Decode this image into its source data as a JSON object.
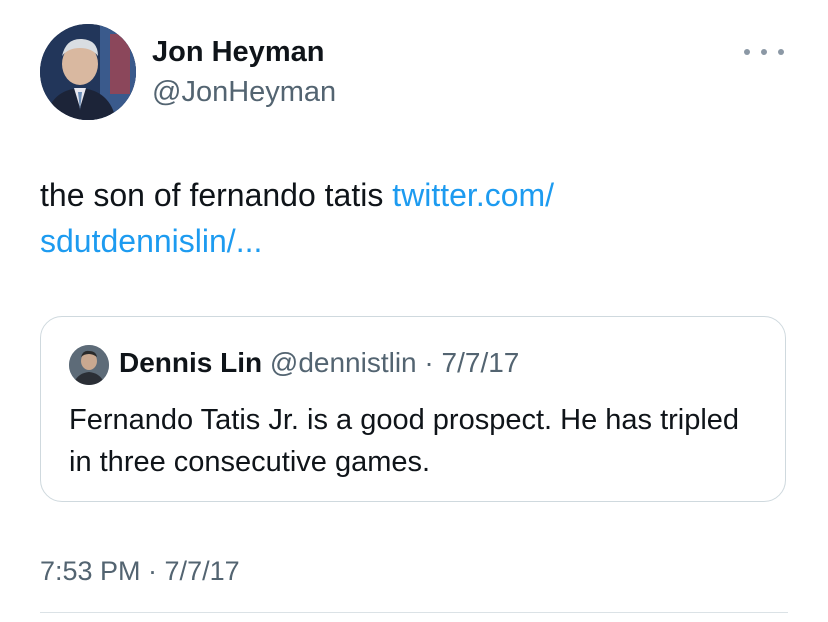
{
  "author": {
    "name": "Jon Heyman",
    "handle": "@JonHeyman"
  },
  "tweet": {
    "text_prefix": "the son of fernando tatis ",
    "link_line1": "twitter.com/",
    "link_line2": "sdutdennislin/..."
  },
  "quote": {
    "name": "Dennis Lin",
    "handle": "@dennistlin",
    "separator": " · ",
    "date": "7/7/17",
    "text": "Fernando Tatis Jr. is a good prospect. He has tripled in three consecutive games."
  },
  "timestamp": "7:53 PM · 7/7/17",
  "icons": {
    "more": "more-horizontal-icon"
  },
  "colors": {
    "link": "#1d9bf0",
    "secondary": "#536471",
    "border": "#cfd9de"
  }
}
